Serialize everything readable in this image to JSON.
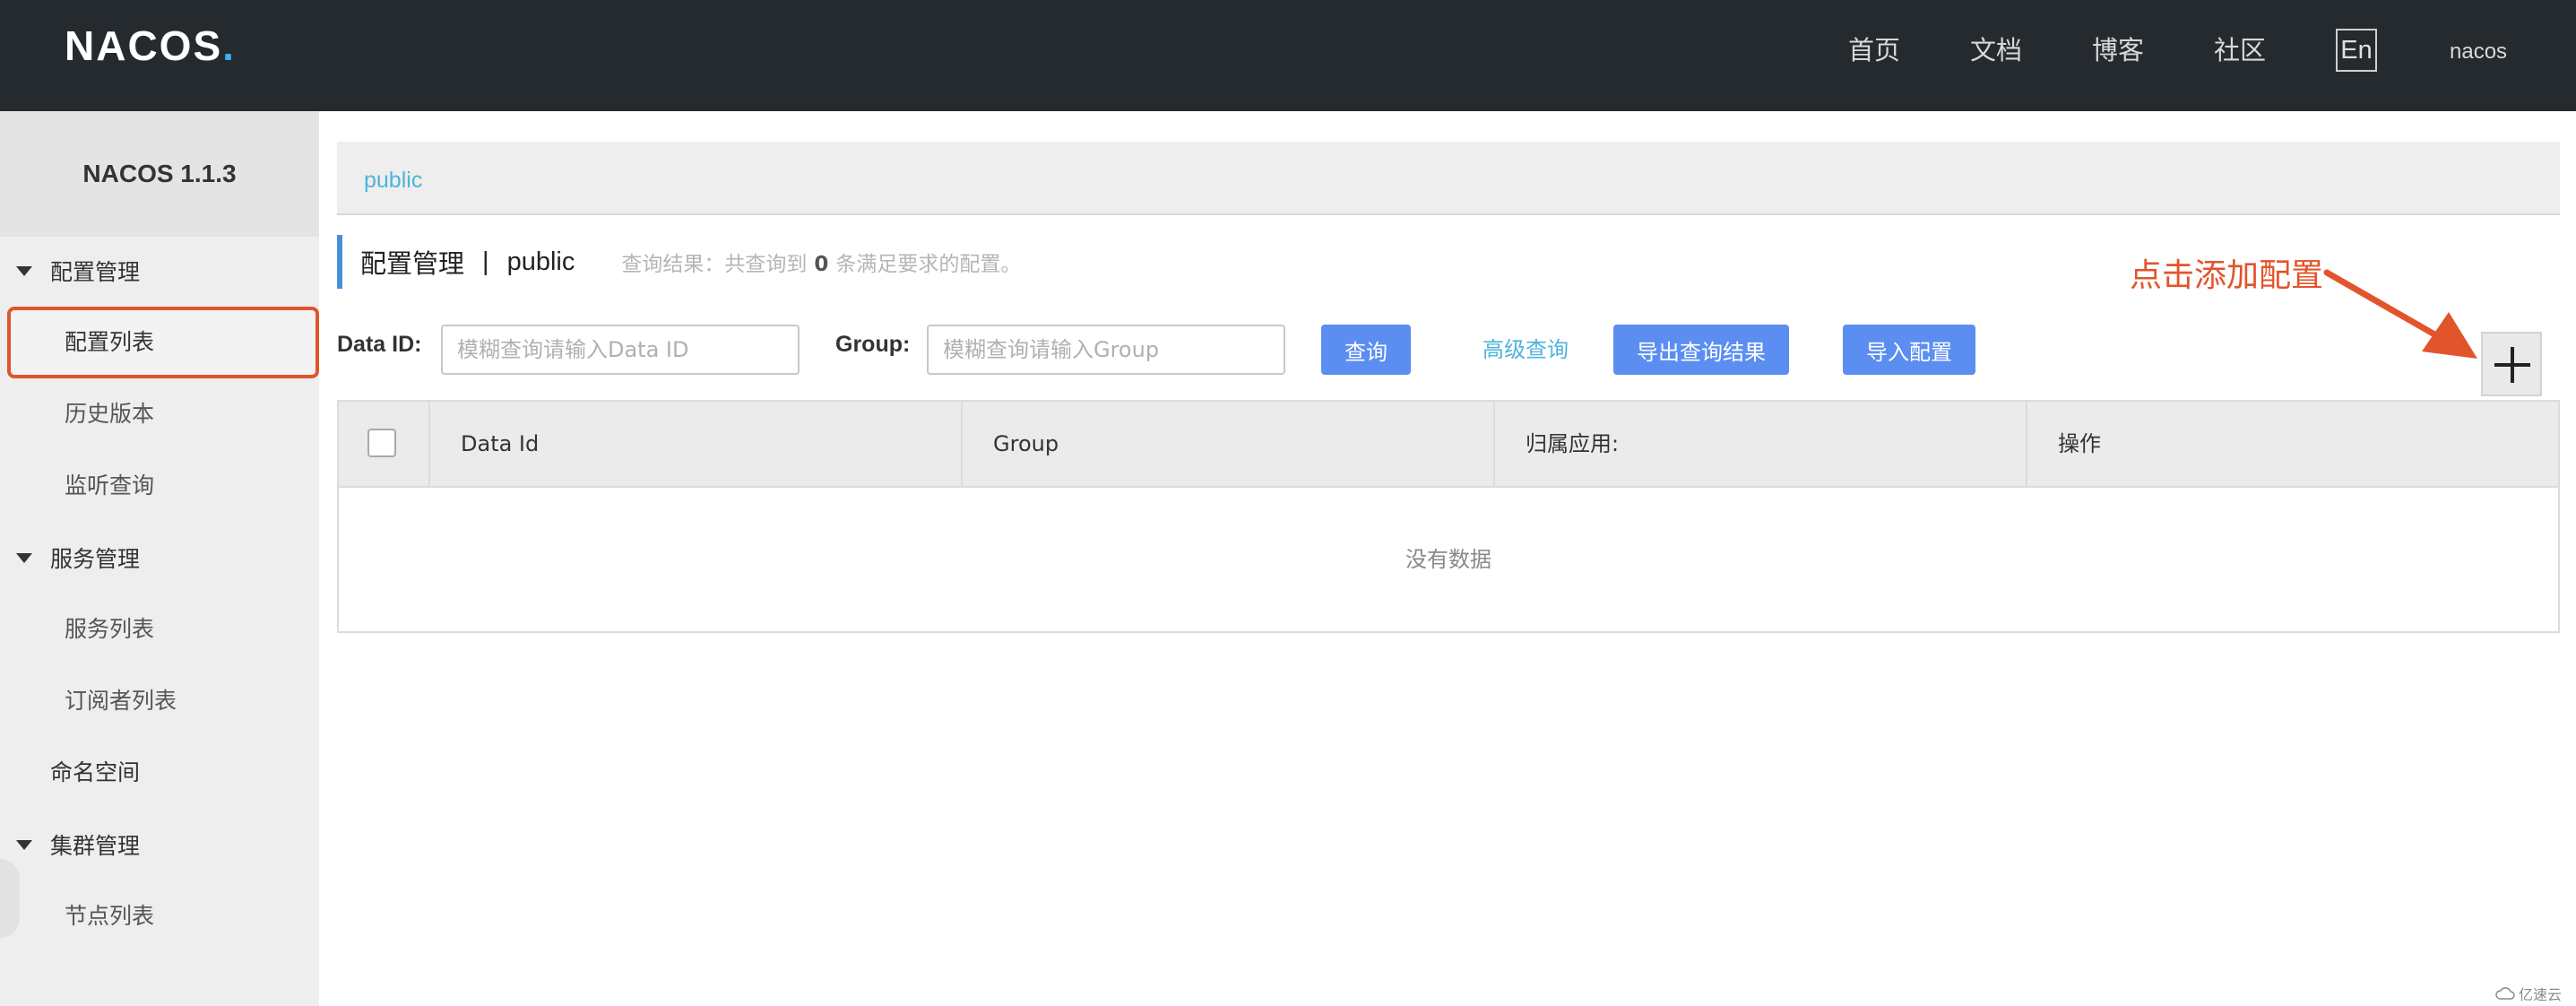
{
  "header": {
    "logo": "NACOS",
    "logo_dot": ".",
    "nav": [
      "首页",
      "文档",
      "博客",
      "社区"
    ],
    "lang_label": "En",
    "user": "nacos"
  },
  "sidebar": {
    "title": "NACOS 1.1.3",
    "groups": [
      {
        "label": "配置管理",
        "items": [
          "配置列表",
          "历史版本",
          "监听查询"
        ]
      },
      {
        "label": "服务管理",
        "items": [
          "服务列表",
          "订阅者列表"
        ]
      },
      {
        "label": "集群管理",
        "items": [
          "节点列表"
        ]
      }
    ],
    "namespace_item": "命名空间",
    "active_item": "配置列表"
  },
  "breadcrumb": {
    "namespace": "public"
  },
  "section": {
    "title": "配置管理",
    "separator": "|",
    "namespace": "public",
    "result_prefix": "查询结果：共查询到",
    "result_count": "0",
    "result_suffix": "条满足要求的配置。"
  },
  "annotation": {
    "text": "点击添加配置",
    "color": "#e2542b"
  },
  "filters": {
    "data_id_label": "Data ID:",
    "data_id_placeholder": "模糊查询请输入Data ID",
    "data_id_value": "",
    "group_label": "Group:",
    "group_placeholder": "模糊查询请输入Group",
    "group_value": "",
    "query_button": "查询",
    "advanced_query": "高级查询",
    "export_button": "导出查询结果",
    "import_button": "导入配置"
  },
  "table": {
    "columns": [
      "Data Id",
      "Group",
      "归属应用:",
      "操作"
    ],
    "rows": [],
    "empty_text": "没有数据"
  },
  "watermark": "亿速云",
  "colors": {
    "header_bg": "#252a2f",
    "accent": "#5b8ef0",
    "link": "#4fb3dc",
    "highlight": "#e2542b"
  },
  "icons": {
    "add": "plus-icon",
    "watermark": "cloud-icon"
  }
}
